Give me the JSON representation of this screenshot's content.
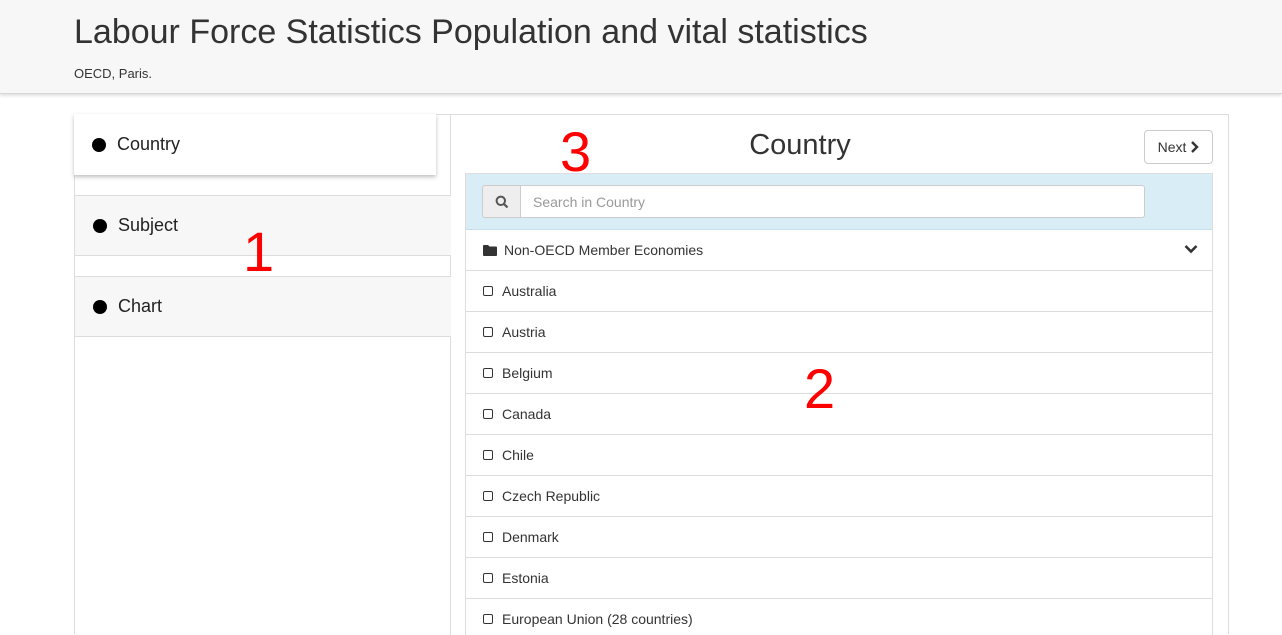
{
  "header": {
    "title": "Labour Force Statistics Population and vital statistics",
    "subtitle": "OECD, Paris."
  },
  "steps": [
    {
      "label": "Country",
      "active": true
    },
    {
      "label": "Subject",
      "active": false
    },
    {
      "label": "Chart",
      "active": false
    }
  ],
  "panel": {
    "title": "Country",
    "next_label": "Next",
    "search_placeholder": "Search in Country",
    "search_value": "",
    "group": "Non-OECD Member Economies",
    "items": [
      "Australia",
      "Austria",
      "Belgium",
      "Canada",
      "Chile",
      "Czech Republic",
      "Denmark",
      "Estonia",
      "European Union (28 countries)"
    ]
  },
  "annotations": {
    "one": "1",
    "two": "2",
    "three": "3"
  },
  "colors": {
    "search_bar": "#d9edf7",
    "annotation": "#ff0000",
    "header_bg": "#f7f7f7"
  },
  "icons": {
    "search": "search-icon",
    "folder": "folder-icon",
    "chevron": "chevron-down-icon",
    "next": "chevron-right-icon",
    "checkbox": "checkbox-icon"
  }
}
